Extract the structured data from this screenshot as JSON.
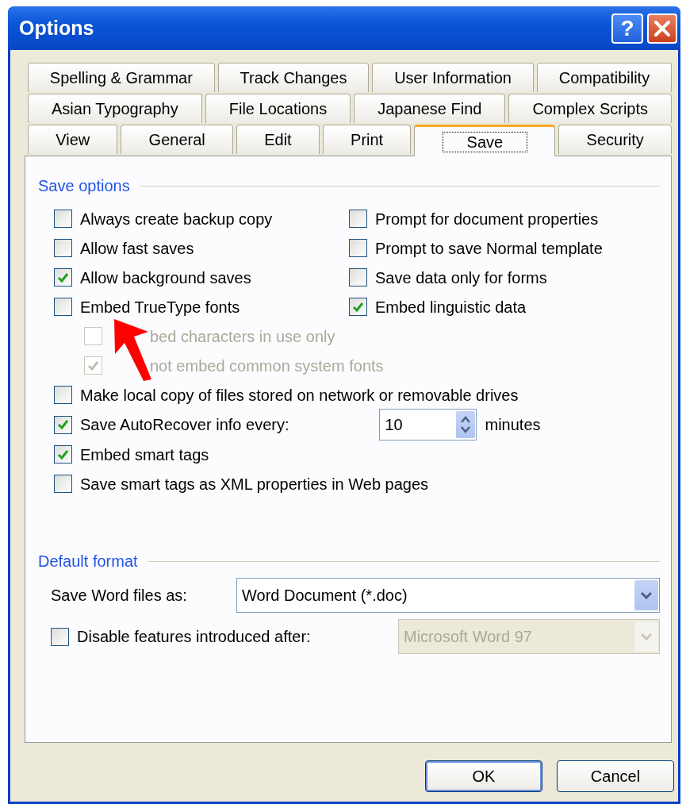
{
  "window": {
    "title": "Options",
    "help_label": "?"
  },
  "tab_rows": [
    [
      {
        "label": "Spelling & Grammar",
        "selected": false
      },
      {
        "label": "Track Changes",
        "selected": false
      },
      {
        "label": "User Information",
        "selected": false
      },
      {
        "label": "Compatibility",
        "selected": false
      }
    ],
    [
      {
        "label": "Asian Typography",
        "selected": false
      },
      {
        "label": "File Locations",
        "selected": false
      },
      {
        "label": "Japanese Find",
        "selected": false
      },
      {
        "label": "Complex Scripts",
        "selected": false
      }
    ],
    [
      {
        "label": "View",
        "selected": false
      },
      {
        "label": "General",
        "selected": false
      },
      {
        "label": "Edit",
        "selected": false
      },
      {
        "label": "Print",
        "selected": false
      },
      {
        "label": "Save",
        "selected": true
      },
      {
        "label": "Security",
        "selected": false
      }
    ]
  ],
  "save_options": {
    "legend": "Save options",
    "columns": [
      [
        {
          "label": "Always create backup copy",
          "checked": false
        },
        {
          "label": "Allow fast saves",
          "checked": false
        },
        {
          "label": "Allow background saves",
          "checked": true
        },
        {
          "label": "Embed TrueType fonts",
          "checked": false
        }
      ],
      [
        {
          "label": "Prompt for document properties",
          "checked": false
        },
        {
          "label": "Prompt to save Normal template",
          "checked": false
        },
        {
          "label": "Save data only for forms",
          "checked": false
        },
        {
          "label": "Embed linguistic data",
          "checked": true
        }
      ]
    ],
    "sub_options": [
      {
        "label": "bed characters in use only",
        "checked": false,
        "disabled": true
      },
      {
        "label": "not embed common system fonts",
        "checked": true,
        "disabled": true
      }
    ],
    "more_options": [
      {
        "kind": "check",
        "label": "Make local copy of files stored on network or removable drives",
        "checked": false
      },
      {
        "kind": "spin",
        "label": "Save AutoRecover info every:",
        "checked": true,
        "value": "10",
        "suffix": "minutes"
      },
      {
        "kind": "check",
        "label": "Embed smart tags",
        "checked": true
      },
      {
        "kind": "check",
        "label": "Save smart tags as XML properties in Web pages",
        "checked": false
      }
    ]
  },
  "default_format": {
    "legend": "Default format",
    "save_as": {
      "label": "Save Word files as:",
      "value": "Word Document (*.doc)"
    },
    "disable_features": {
      "label": "Disable features introduced after:",
      "checked": false,
      "value": "Microsoft Word 97",
      "disabled": true
    }
  },
  "buttons": [
    "OK",
    "Cancel"
  ]
}
